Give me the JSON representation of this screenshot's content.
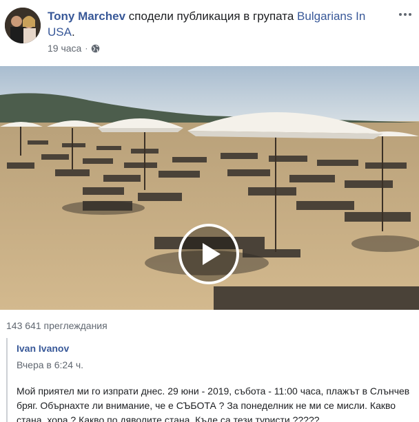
{
  "post": {
    "author": "Tony Marchev",
    "action": "сподели публикация в групата",
    "group": "Bulgarians In USA",
    "period": ".",
    "time": "19 часа",
    "privacy_icon": "globe-icon",
    "more_icon": "more-options-icon"
  },
  "video": {
    "play_icon": "play-icon",
    "views": "143 641 преглеждания"
  },
  "quoted": {
    "author": "Ivan Ivanov",
    "date": "Вчера в 6:24 ч.",
    "text": "Мой приятел ми го изпрати днес. 29 юни - 2019, събота - 11:00 часа, плажът в Слънчев бряг. Обърнахте ли внимание, че е СЪБОТА ? За понеделник не ми се мисли. Какво стана, хора ? Какво по дяволите стана. Къде са тези туристи ?????"
  },
  "colors": {
    "link": "#385898",
    "meta": "#606770",
    "text": "#1c1e21",
    "quote_border": "#ccd0d5"
  }
}
